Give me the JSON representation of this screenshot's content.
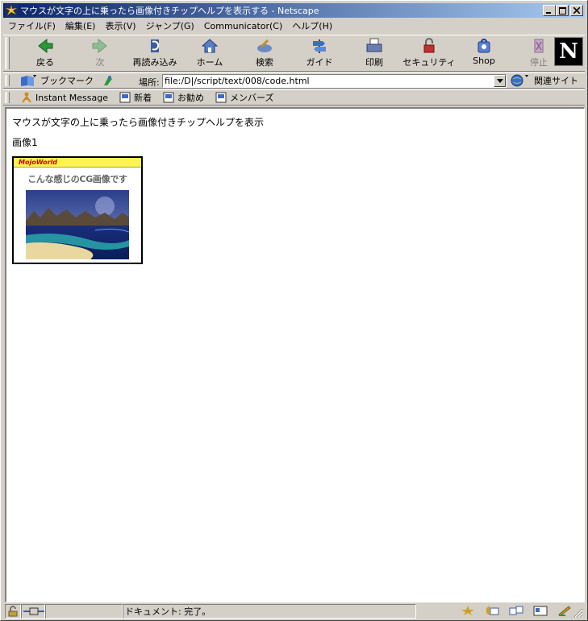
{
  "window": {
    "title": "マウスが文字の上に乗ったら画像付きチップヘルプを表示する - Netscape"
  },
  "menu": [
    "ファイル(F)",
    "編集(E)",
    "表示(V)",
    "ジャンプ(G)",
    "Communicator(C)",
    "ヘルプ(H)"
  ],
  "nav_toolbar": [
    {
      "label": "戻る",
      "icon": "back-icon",
      "enabled": true
    },
    {
      "label": "次",
      "icon": "forward-icon",
      "enabled": false
    },
    {
      "label": "再読み込み",
      "icon": "reload-icon",
      "enabled": true
    },
    {
      "label": "ホーム",
      "icon": "home-icon",
      "enabled": true
    },
    {
      "label": "検索",
      "icon": "search-icon",
      "enabled": true
    },
    {
      "label": "ガイド",
      "icon": "guide-icon",
      "enabled": true
    },
    {
      "label": "印刷",
      "icon": "print-icon",
      "enabled": true
    },
    {
      "label": "セキュリティ",
      "icon": "security-icon",
      "enabled": true
    },
    {
      "label": "Shop",
      "icon": "shop-icon",
      "enabled": true
    },
    {
      "label": "停止",
      "icon": "stop-icon",
      "enabled": false
    }
  ],
  "location_bar": {
    "bookmarks_label": "ブックマーク",
    "location_label": "場所:",
    "url": "file:/D|/script/text/008/code.html",
    "related_label": "関連サイト"
  },
  "personal_toolbar": [
    "Instant Message",
    "新着",
    "お勧め",
    "メンバーズ"
  ],
  "page": {
    "text": "マウスが文字の上に乗ったら画像付きチップヘルプを表示",
    "image_caption": "画像1",
    "ad": {
      "brand": "MojoWorld",
      "tagline": "こんな感じのCG画像です"
    }
  },
  "status": {
    "message": "ドキュメント: 完了。"
  },
  "colors": {
    "title_start": "#0a246a",
    "title_end": "#a6caf0",
    "chrome": "#d4d0c8",
    "ad_header": "#fff34d"
  }
}
